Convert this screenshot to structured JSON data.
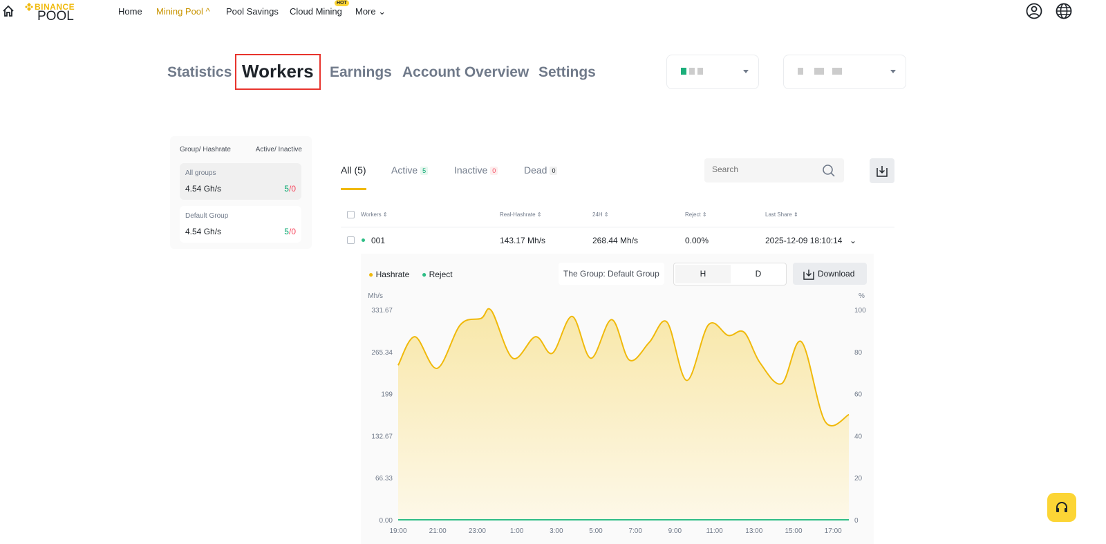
{
  "nav": {
    "logo_top": "BINANCE",
    "logo_bottom": "POOL",
    "items": [
      "Home",
      "Mining Pool",
      "Pool Savings",
      "Cloud Mining",
      "More"
    ],
    "hot": "HOT"
  },
  "main_tabs": [
    "Statistics",
    "Workers",
    "Earnings",
    "Account Overview",
    "Settings"
  ],
  "sidebar": {
    "header_left": "Group/ Hashrate",
    "header_right": "Active/ Inactive",
    "groups": [
      {
        "name": "All groups",
        "hashrate": "4.54 Gh/s",
        "active": "5",
        "inactive": "0"
      },
      {
        "name": "Default Group",
        "hashrate": "4.54 Gh/s",
        "active": "5",
        "inactive": "0"
      }
    ],
    "sep": "/"
  },
  "filters": {
    "all": "All (5)",
    "active": "Active",
    "active_count": "5",
    "inactive": "Inactive",
    "inactive_count": "0",
    "dead": "Dead",
    "dead_count": "0"
  },
  "search": {
    "placeholder": "Search"
  },
  "table": {
    "headers": [
      "Workers",
      "Real-Hashrate",
      "24H",
      "Reject",
      "Last Share"
    ],
    "rows": [
      {
        "worker": "001",
        "real_hashrate": "143.17 Mh/s",
        "h24": "268.44 Mh/s",
        "reject": "0.00%",
        "last_share": "2025-12-09 18:10:14"
      }
    ]
  },
  "chart_panel": {
    "legend_hashrate": "Hashrate",
    "legend_reject": "Reject",
    "group_label": "The Group: Default Group",
    "toggle_h": "H",
    "toggle_d": "D",
    "download": "Download"
  },
  "colors": {
    "accent": "#f0b90b",
    "green": "#2ebd85",
    "red": "#f6465d"
  },
  "chart_data": {
    "type": "line",
    "ylabel_left": "Mh/s",
    "ylabel_right": "%",
    "yticks_left": [
      "0.00",
      "66.33",
      "132.67",
      "199",
      "265.34",
      "331.67"
    ],
    "ylim_left": [
      0,
      331.67
    ],
    "yticks_right": [
      "0",
      "20",
      "40",
      "60",
      "80",
      "100"
    ],
    "ylim_right": [
      0,
      100
    ],
    "xticks": [
      "19:00",
      "21:00",
      "23:00",
      "1:00",
      "3:00",
      "5:00",
      "7:00",
      "9:00",
      "11:00",
      "13:00",
      "15:00",
      "17:00"
    ],
    "x_hours_from_start": [
      0,
      0.85,
      1.97,
      3.15,
      4.2,
      4.72,
      5.8,
      6.95,
      7.8,
      8.8,
      9.75,
      10.8,
      11.7,
      12.7,
      13.6,
      14.6,
      15.7,
      16.7,
      17.5,
      18.3,
      19.4,
      20.4,
      21.6,
      22.8
    ],
    "series": [
      {
        "name": "Hashrate",
        "axis": "left",
        "values": [
          244,
          289,
          239,
          308,
          318,
          330,
          255,
          289,
          263,
          321,
          255,
          316,
          252,
          280,
          312,
          220,
          308,
          291,
          296,
          248,
          215,
          281,
          155,
          166
        ]
      },
      {
        "name": "Reject",
        "axis": "right",
        "values": [
          0,
          0,
          0,
          0,
          0,
          0,
          0,
          0,
          0,
          0,
          0,
          0,
          0,
          0,
          0,
          0,
          0,
          0,
          0,
          0,
          0,
          0,
          0,
          0
        ]
      }
    ]
  }
}
